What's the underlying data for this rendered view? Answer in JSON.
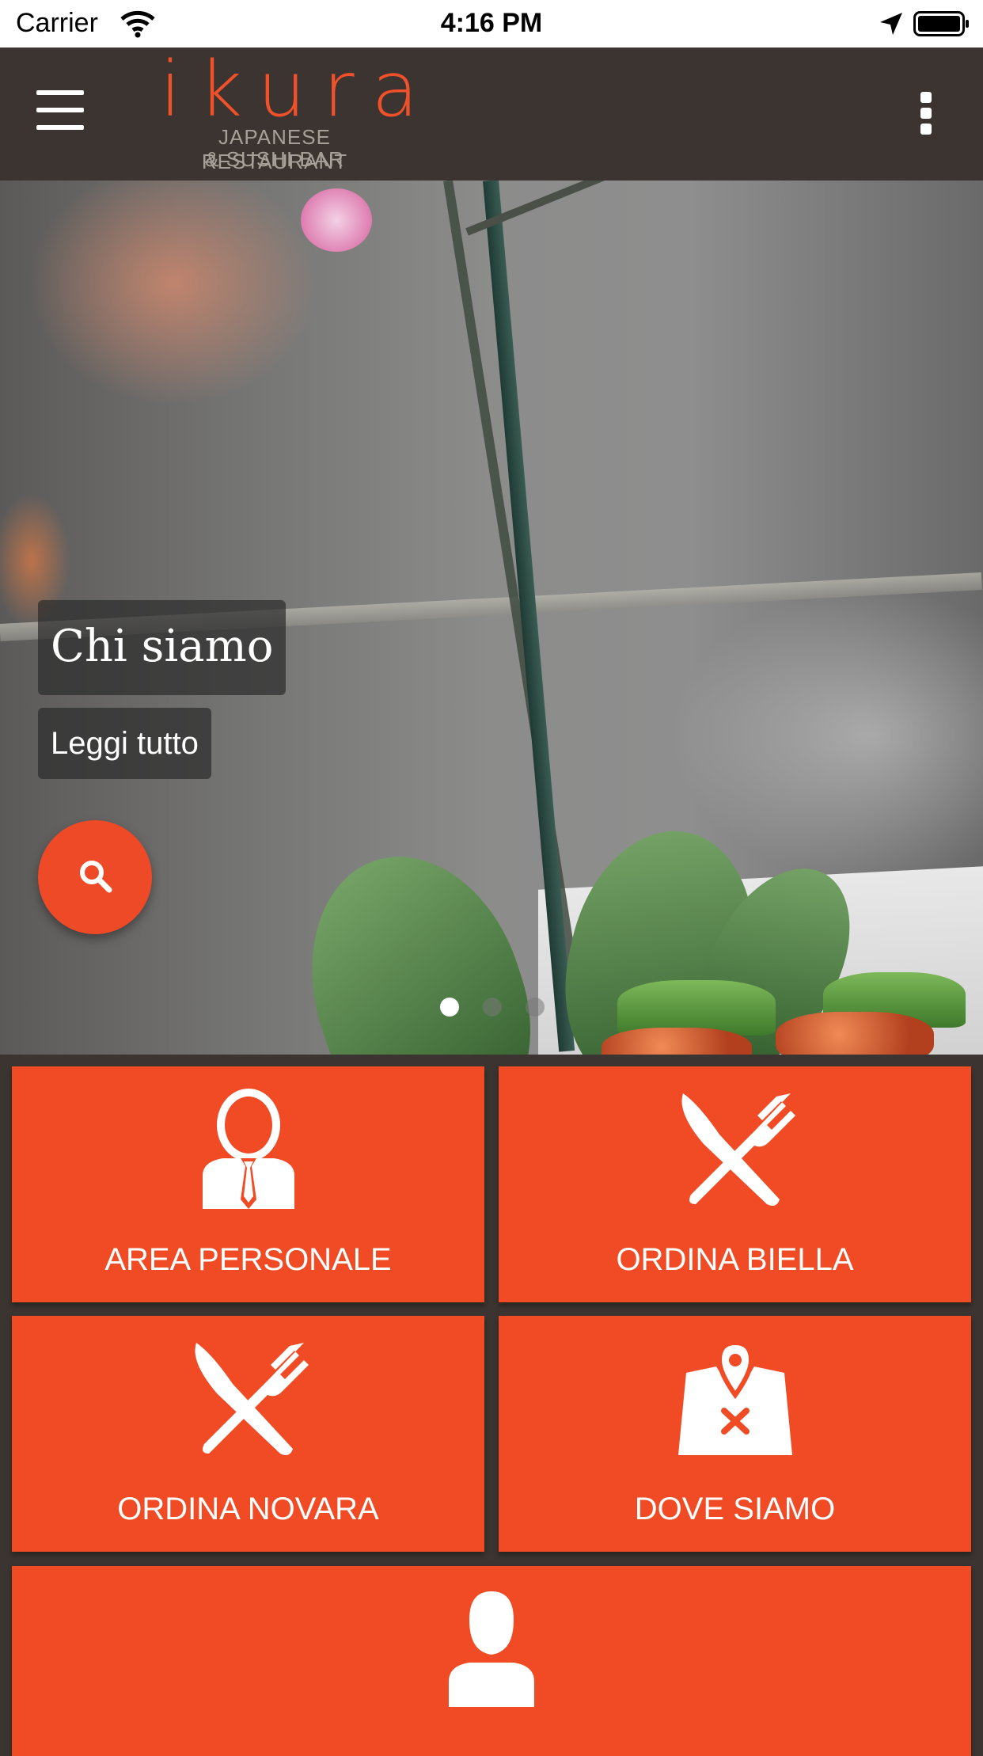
{
  "status_bar": {
    "carrier": "Carrier",
    "time": "4:16 PM"
  },
  "app_bar": {
    "logo": {
      "word": "ikura",
      "line1": "JAPANESE RESTAURANT",
      "line2": "& SUSHI BAR"
    },
    "menu_icon": "hamburger-icon",
    "more_icon": "kebab-menu-icon"
  },
  "hero": {
    "title": "Chi siamo",
    "read_more": "Leggi tutto",
    "search_icon": "search-icon",
    "slides": {
      "total": 3,
      "active": 1
    }
  },
  "tiles": [
    {
      "label": "AREA PERSONALE",
      "icon": "businessman-icon"
    },
    {
      "label": "ORDINA BIELLA",
      "icon": "fork-knife-icon"
    },
    {
      "label": "ORDINA NOVARA",
      "icon": "fork-knife-icon"
    },
    {
      "label": "DOVE SIAMO",
      "icon": "map-pin-icon"
    },
    {
      "label": "",
      "icon": "user-icon"
    }
  ],
  "colors": {
    "accent": "#f04b25",
    "bar": "#3b3430",
    "logo_text": "#a89f98"
  }
}
